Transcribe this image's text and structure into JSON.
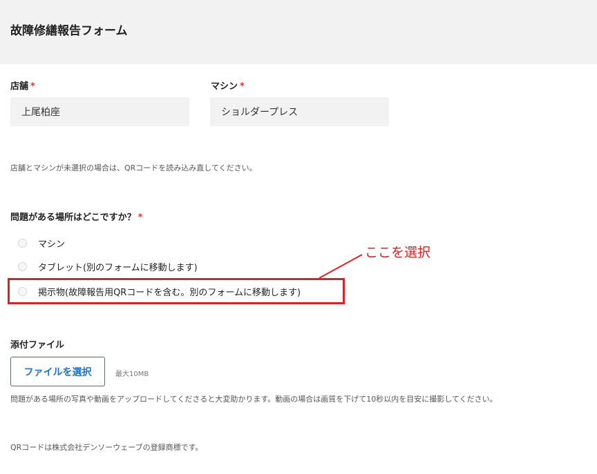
{
  "header": {
    "title": "故障修繕報告フォーム"
  },
  "form": {
    "store": {
      "label": "店舗",
      "required_mark": "*",
      "value": "上尾柏座"
    },
    "machine": {
      "label": "マシン",
      "required_mark": "*",
      "value": "ショルダープレス"
    },
    "qr_hint": "店舗とマシンが未選択の場合は、QRコードを読み込み直してください。",
    "question": {
      "label": "問題がある場所はどこですか？",
      "required_mark": "*",
      "options": [
        {
          "label": "マシン"
        },
        {
          "label": "タブレット(別のフォームに移動します)"
        },
        {
          "label": "掲示物(故障報告用QRコードを含む。別のフォームに移動します)"
        }
      ]
    },
    "attachment": {
      "label": "添付ファイル",
      "button_label": "ファイルを選択",
      "size_limit": "最大10MB",
      "hint": "問題がある場所の写真や動画をアップロードしてくださると大変助かります。動画の場合は画質を下げて10秒以内を目安に撮影してください。"
    },
    "footer_note": "QRコードは株式会社デンソーウェーブの登録商標です。"
  },
  "annotation": {
    "text": "ここを選択",
    "color": "#e02020"
  },
  "colors": {
    "accent": "#1e73c8",
    "required": "#e3342f",
    "annotation": "#e02020"
  }
}
